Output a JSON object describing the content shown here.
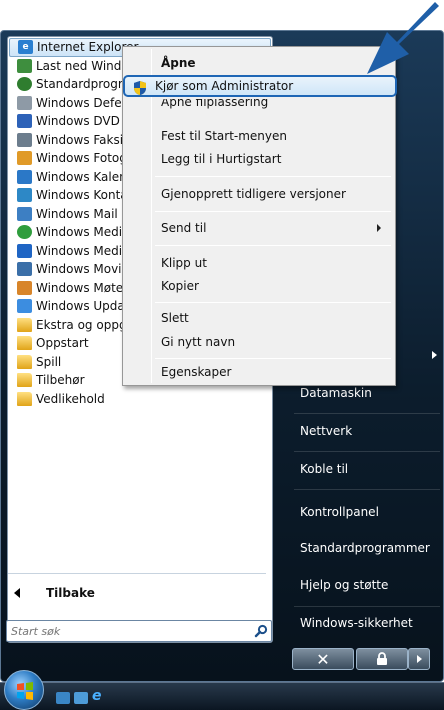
{
  "programs": [
    {
      "label": "Internet Explorer",
      "icon": "ie-icon",
      "color": "#2a7fd0",
      "selected": true
    },
    {
      "label": "Last ned Windows",
      "icon": "people-icon",
      "color": "#3e8e3e"
    },
    {
      "label": "Standardprogrammer",
      "icon": "default-programs-icon",
      "color": "#2f7d2f"
    },
    {
      "label": "Windows Defender",
      "icon": "defender-icon",
      "color": "#8e9aa6"
    },
    {
      "label": "Windows DVD Maker",
      "icon": "dvd-maker-icon",
      "color": "#2d62b8"
    },
    {
      "label": "Windows Faksing og skanning",
      "icon": "fax-icon",
      "color": "#6c7d8d"
    },
    {
      "label": "Windows Fotogalleri",
      "icon": "photo-gallery-icon",
      "color": "#e09a28"
    },
    {
      "label": "Windows Kalender",
      "icon": "calendar-icon",
      "color": "#2b78c7"
    },
    {
      "label": "Windows Kontakter",
      "icon": "contacts-icon",
      "color": "#2d88c6"
    },
    {
      "label": "Windows Mail",
      "icon": "mail-icon",
      "color": "#3d7fc3"
    },
    {
      "label": "Windows Media Center",
      "icon": "media-center-icon",
      "color": "#2f9d3d"
    },
    {
      "label": "Windows Media Player",
      "icon": "media-player-icon",
      "color": "#1f65c4"
    },
    {
      "label": "Windows Movie Maker",
      "icon": "movie-maker-icon",
      "color": "#3b6fa8"
    },
    {
      "label": "Windows Møterom",
      "icon": "meeting-space-icon",
      "color": "#d8852a"
    },
    {
      "label": "Windows Update",
      "icon": "windows-update-icon",
      "color": "#3c8de0"
    },
    {
      "label": "Ekstra og oppgraderinger",
      "icon": "folder-icon",
      "folder": true
    },
    {
      "label": "Oppstart",
      "icon": "folder-icon",
      "folder": true
    },
    {
      "label": "Spill",
      "icon": "folder-icon",
      "folder": true
    },
    {
      "label": "Tilbehør",
      "icon": "folder-icon",
      "folder": true
    },
    {
      "label": "Vedlikehold",
      "icon": "folder-icon",
      "folder": true
    }
  ],
  "back_label": "Tilbake",
  "search_placeholder": "Start søk",
  "right_pane": [
    {
      "label": "Datamaskin"
    },
    {
      "label": "Nettverk"
    },
    {
      "label": "Koble til"
    },
    {
      "label": "Kontrollpanel"
    },
    {
      "label": "Standardprogrammer"
    },
    {
      "label": "Hjelp og støtte"
    },
    {
      "label": "Windows-sikkerhet"
    }
  ],
  "context_menu": {
    "items": [
      {
        "label": "Åpne",
        "bold": true
      },
      {
        "label": "Kjør som Administrator",
        "highlighted": true,
        "icon": "uac-shield-icon"
      },
      {
        "label": "Åpne filplassering"
      },
      {
        "label": "Fest til Start-menyen"
      },
      {
        "label": "Legg til i Hurtigstart"
      },
      {
        "label": "Gjenopprett tidligere versjoner"
      },
      {
        "label": "Send til",
        "submenu": true
      },
      {
        "label": "Klipp ut"
      },
      {
        "label": "Kopier"
      },
      {
        "label": "Slett"
      },
      {
        "label": "Gi nytt navn"
      },
      {
        "label": "Egenskaper"
      }
    ]
  },
  "colors": {
    "accent": "#1e66b5",
    "menu_bg": "#f0f0f0",
    "callout_arrow": "#1f5fa8"
  }
}
